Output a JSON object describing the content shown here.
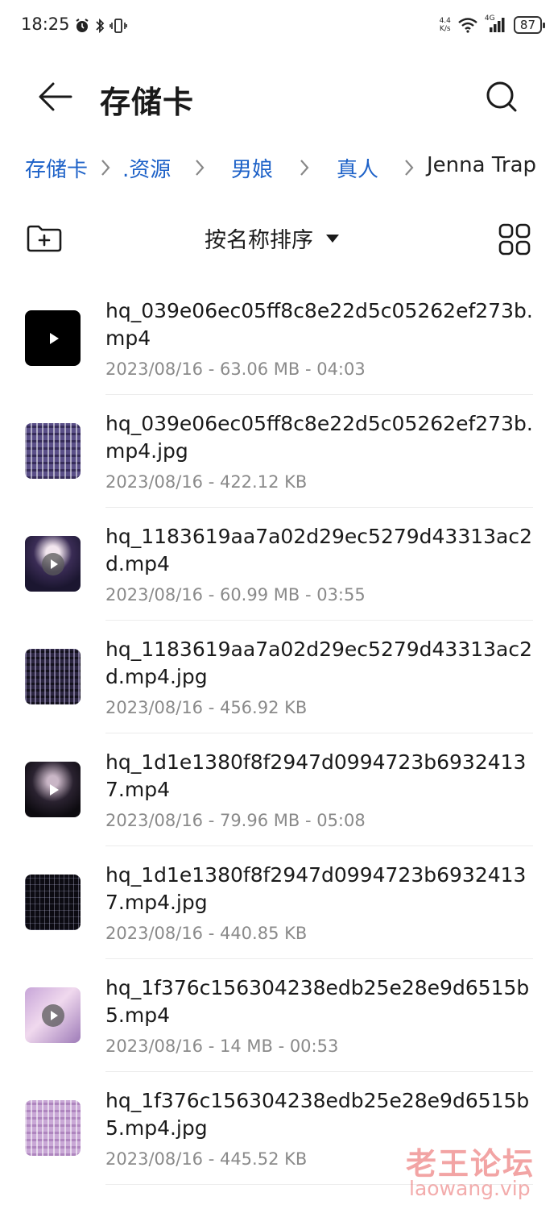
{
  "status_bar": {
    "time": "18:25",
    "net_speed_value": "4.4",
    "net_speed_unit": "K/s",
    "network_label": "4G",
    "battery": "87"
  },
  "header": {
    "title": "存储卡"
  },
  "breadcrumb": [
    {
      "label": "存储卡"
    },
    {
      "label": ".资源"
    },
    {
      "label": "男娘"
    },
    {
      "label": "真人"
    },
    {
      "label": "Jenna Trap"
    }
  ],
  "toolbar": {
    "sort_label": "按名称排序"
  },
  "files": [
    {
      "name": "hq_039e06ec05ff8c8e22d5c05262ef273b.mp4",
      "meta": "2023/08/16 - 63.06 MB - 04:03",
      "thumb": "video-black"
    },
    {
      "name": "hq_039e06ec05ff8c8e22d5c05262ef273b.mp4.jpg",
      "meta": "2023/08/16 - 422.12 KB",
      "thumb": "purple-grid"
    },
    {
      "name": "hq_1183619aa7a02d29ec5279d43313ac2d.mp4",
      "meta": "2023/08/16 - 60.99 MB - 03:55",
      "thumb": "photo-purple"
    },
    {
      "name": "hq_1183619aa7a02d29ec5279d43313ac2d.mp4.jpg",
      "meta": "2023/08/16 - 456.92 KB",
      "thumb": "dark-grid"
    },
    {
      "name": "hq_1d1e1380f8f2947d0994723b69324137.mp4",
      "meta": "2023/08/16 - 79.96 MB - 05:08",
      "thumb": "photo-dark"
    },
    {
      "name": "hq_1d1e1380f8f2947d0994723b69324137.mp4.jpg",
      "meta": "2023/08/16 - 440.85 KB",
      "thumb": "black-grid"
    },
    {
      "name": "hq_1f376c156304238edb25e28e9d6515b5.mp4",
      "meta": "2023/08/16 - 14 MB - 00:53",
      "thumb": "photo-pink"
    },
    {
      "name": "hq_1f376c156304238edb25e28e9d6515b5.mp4.jpg",
      "meta": "2023/08/16 - 445.52 KB",
      "thumb": "pink-grid"
    }
  ],
  "watermark": {
    "cn": "老王论坛",
    "en": "laowang.vip"
  },
  "colors": {
    "link": "#1e62c8",
    "meta_text": "#8a8a8a",
    "watermark": "#e85a5a"
  },
  "icons": {
    "back": "arrow-left-icon",
    "search": "search-icon",
    "new_folder": "new-folder-icon",
    "sort": "caret-down-icon",
    "grid": "grid-view-icon"
  }
}
